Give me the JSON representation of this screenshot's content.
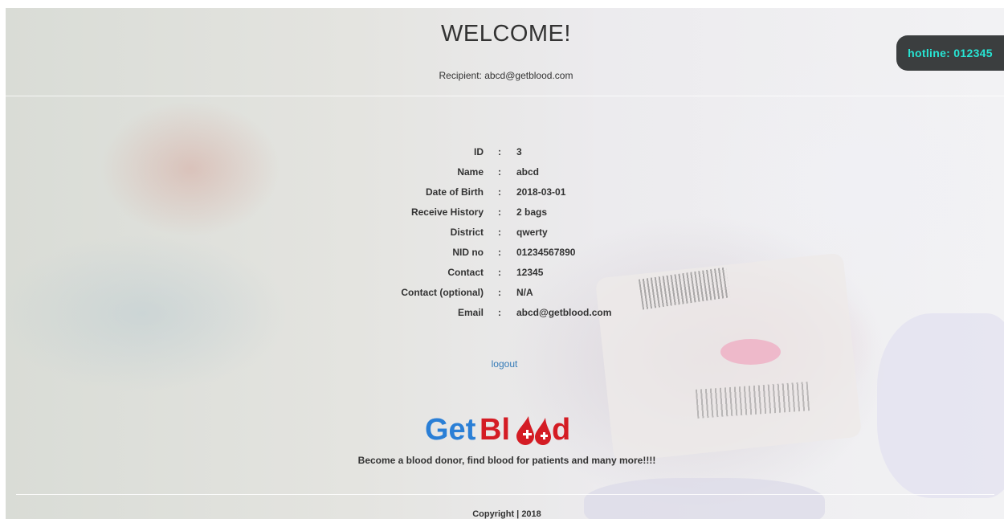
{
  "header": {
    "title": "WELCOME!",
    "recipient": "Recipient: abcd@getblood.com"
  },
  "hotline": "hotline: 012345",
  "profile": [
    {
      "label": "ID",
      "sep": ":",
      "value": "3"
    },
    {
      "label": "Name",
      "sep": ":",
      "value": "abcd"
    },
    {
      "label": "Date of Birth",
      "sep": ":",
      "value": "2018-03-01"
    },
    {
      "label": "Receive History",
      "sep": ":",
      "value": "2 bags"
    },
    {
      "label": "District",
      "sep": ":",
      "value": "qwerty"
    },
    {
      "label": "NID no",
      "sep": ":",
      "value": "01234567890"
    },
    {
      "label": "Contact",
      "sep": ":",
      "value": "12345"
    },
    {
      "label": "Contact (optional)",
      "sep": ":",
      "value": "N/A"
    },
    {
      "label": "Email",
      "sep": ":",
      "value": "abcd@getblood.com"
    }
  ],
  "logout_label": "logout",
  "logo": {
    "part1": "Get",
    "part2": "Bl",
    "part3": "d"
  },
  "tagline": "Become a blood donor, find blood for patients and many more!!!!",
  "footer": {
    "copyright": "Copyright | 2018"
  },
  "colors": {
    "hotline_text": "#27e5d4",
    "hotline_bg": "#3b3e3f",
    "logo_blue": "#2a7fd6",
    "logo_red": "#d41c24",
    "link": "#337ab7"
  }
}
